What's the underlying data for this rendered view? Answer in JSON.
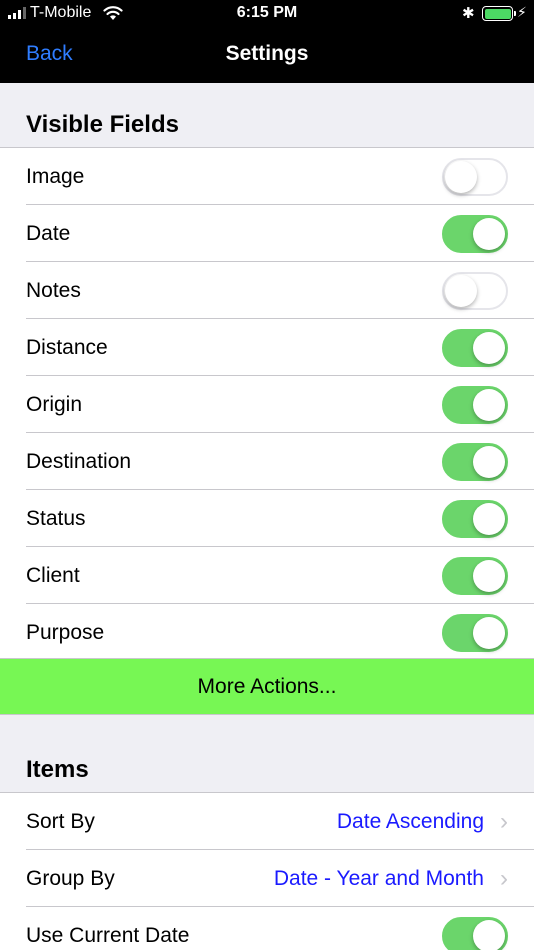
{
  "status_bar": {
    "carrier": "T-Mobile",
    "time": "6:15 PM",
    "bluetooth_icon": "bluetooth-icon",
    "battery_icon": "battery-charging-icon"
  },
  "nav": {
    "back_label": "Back",
    "title": "Settings"
  },
  "visible_fields": {
    "header": "Visible Fields",
    "items": [
      {
        "label": "Image",
        "on": false
      },
      {
        "label": "Date",
        "on": true
      },
      {
        "label": "Notes",
        "on": false
      },
      {
        "label": "Distance",
        "on": true
      },
      {
        "label": "Origin",
        "on": true
      },
      {
        "label": "Destination",
        "on": true
      },
      {
        "label": "Status",
        "on": true
      },
      {
        "label": "Client",
        "on": true
      },
      {
        "label": "Purpose",
        "on": true
      }
    ],
    "more_actions_label": "More Actions..."
  },
  "items": {
    "header": "Items",
    "sort_by": {
      "label": "Sort By",
      "value": "Date Ascending"
    },
    "group_by": {
      "label": "Group By",
      "value": "Date - Year and Month"
    },
    "use_current_date": {
      "label": "Use Current Date",
      "on": true
    }
  },
  "colors": {
    "toggle_on": "#6bd56b",
    "more_actions_bg": "#77f754",
    "value_text": "#1a1aff",
    "back_link": "#2f7dff"
  }
}
